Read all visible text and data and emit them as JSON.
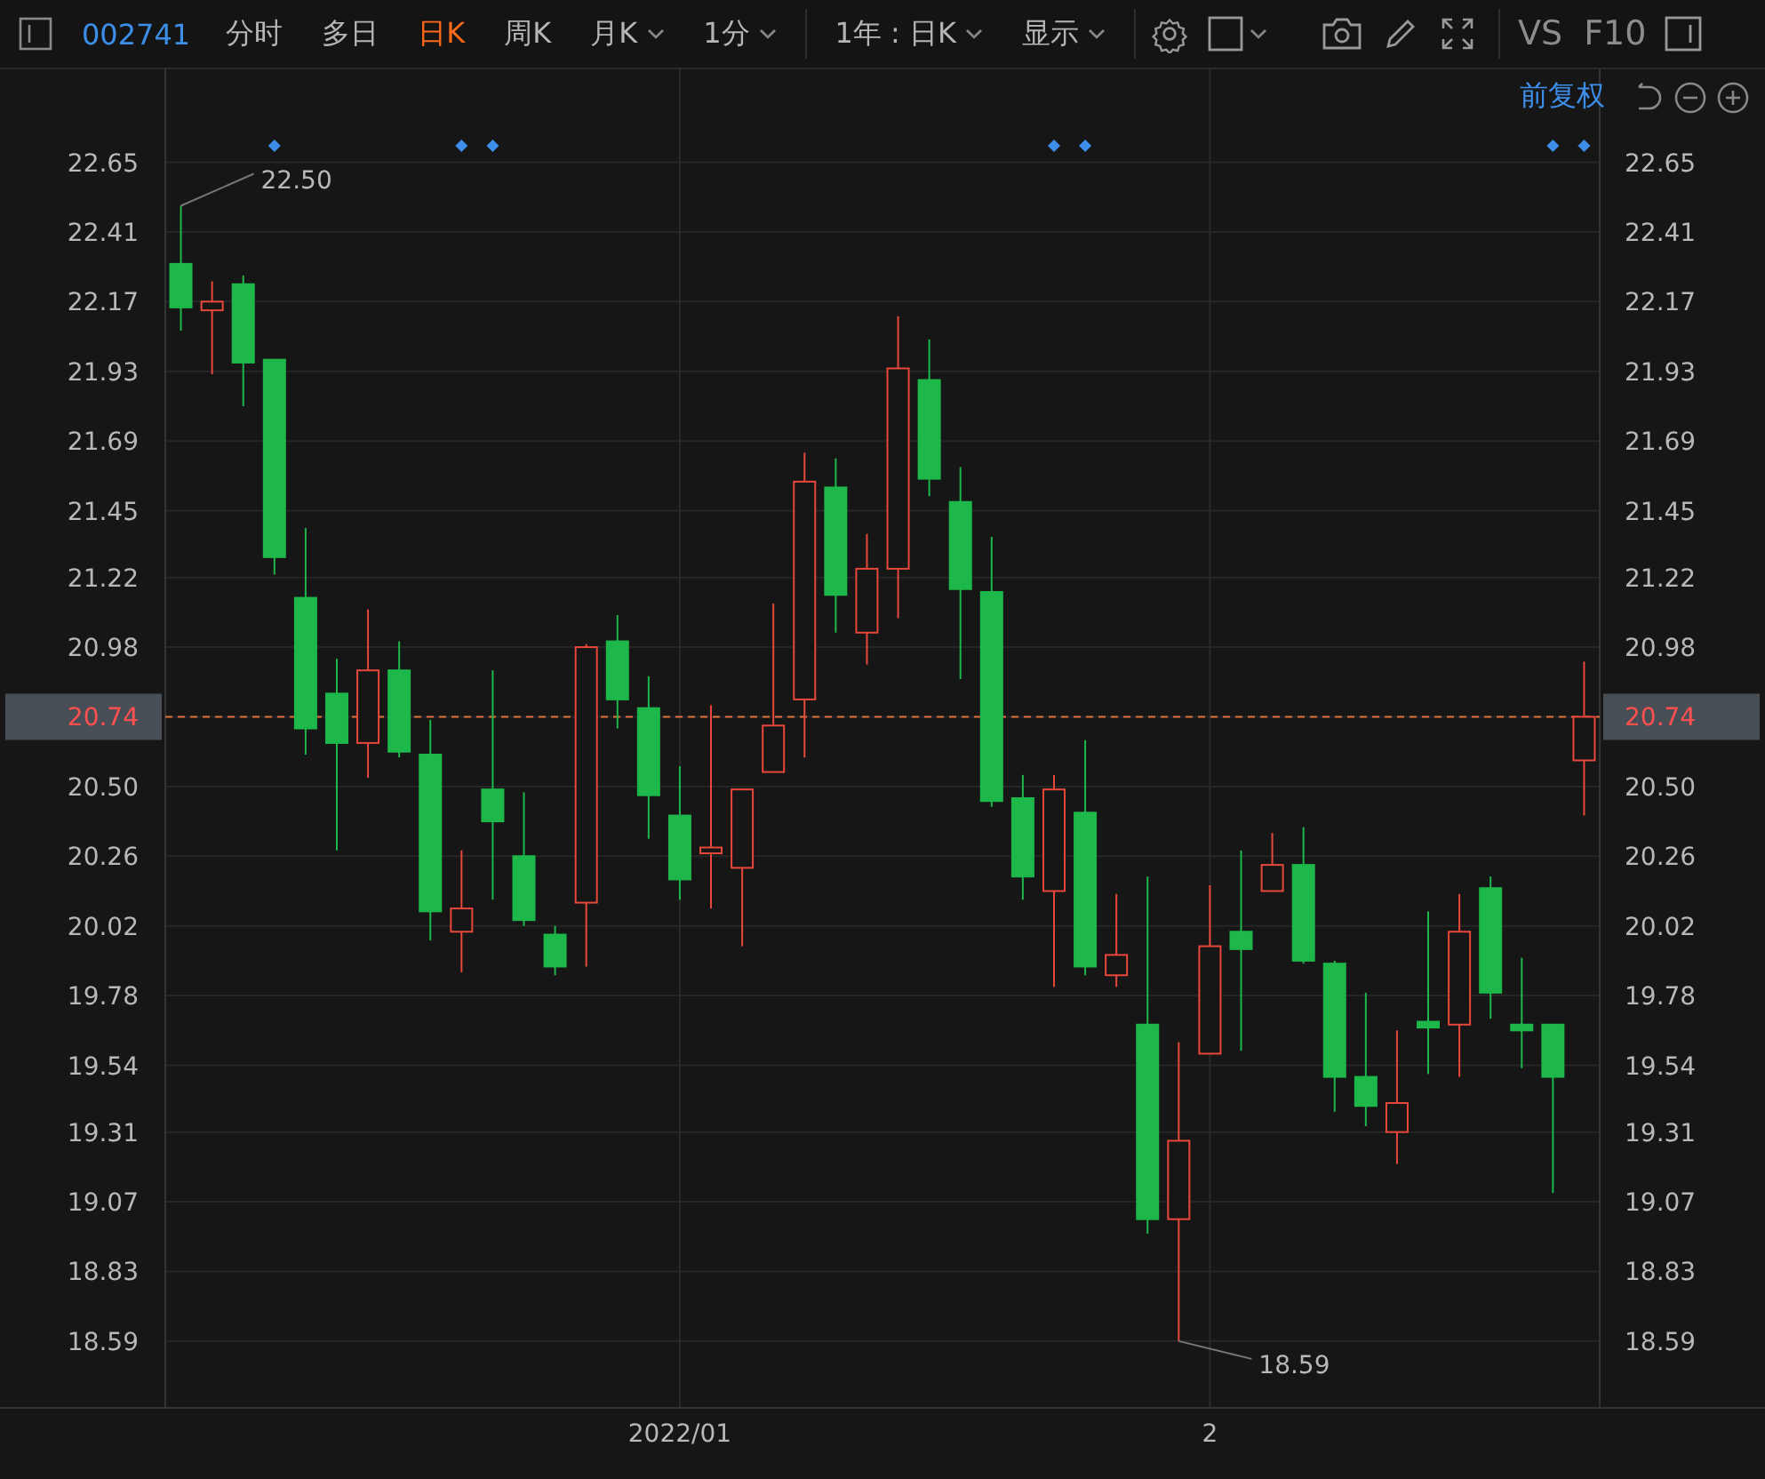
{
  "toolbar": {
    "symbol": "002741",
    "periods": [
      {
        "label": "分时",
        "selected": false,
        "dropdown": false
      },
      {
        "label": "多日",
        "selected": false,
        "dropdown": false
      },
      {
        "label": "日K",
        "selected": true,
        "dropdown": false
      },
      {
        "label": "周K",
        "selected": false,
        "dropdown": false
      },
      {
        "label": "月K",
        "selected": false,
        "dropdown": true
      },
      {
        "label": "1分",
        "selected": false,
        "dropdown": true
      }
    ],
    "range": "1年 : 日K",
    "display": "显示",
    "compare": "VS",
    "f10": "F10"
  },
  "adjust": "前复权",
  "event_flags": [
    false,
    false,
    false,
    true,
    false,
    false,
    false,
    false,
    false,
    true,
    true,
    false,
    false,
    false,
    false,
    false,
    false,
    false,
    false,
    false,
    false,
    false,
    false,
    false,
    false,
    false,
    false,
    false,
    true,
    true,
    false,
    false,
    false,
    false,
    false,
    false,
    false,
    false,
    false,
    false,
    false,
    false,
    false,
    false,
    true,
    true
  ],
  "chart_data": {
    "type": "candlestick",
    "grid": true,
    "ylim": [
      18.36,
      22.97
    ],
    "yticks": [
      {
        "value": 22.65,
        "label": "22.65"
      },
      {
        "value": 22.41,
        "label": "22.41"
      },
      {
        "value": 22.17,
        "label": "22.17"
      },
      {
        "value": 21.93,
        "label": "21.93"
      },
      {
        "value": 21.69,
        "label": "21.69"
      },
      {
        "value": 21.45,
        "label": "21.45"
      },
      {
        "value": 21.22,
        "label": "21.22"
      },
      {
        "value": 20.98,
        "label": "20.98"
      },
      {
        "value": 20.74,
        "label": "20.74"
      },
      {
        "value": 20.5,
        "label": "20.50"
      },
      {
        "value": 20.26,
        "label": "20.26"
      },
      {
        "value": 20.02,
        "label": "20.02"
      },
      {
        "value": 19.78,
        "label": "19.78"
      },
      {
        "value": 19.54,
        "label": "19.54"
      },
      {
        "value": 19.31,
        "label": "19.31"
      },
      {
        "value": 19.07,
        "label": "19.07"
      },
      {
        "value": 18.83,
        "label": "18.83"
      },
      {
        "value": 18.59,
        "label": "18.59"
      }
    ],
    "categories": [
      null,
      null,
      null,
      null,
      null,
      null,
      null,
      null,
      null,
      null,
      null,
      null,
      null,
      null,
      null,
      null,
      "2022/01",
      null,
      null,
      null,
      null,
      null,
      null,
      null,
      null,
      null,
      null,
      null,
      null,
      null,
      null,
      null,
      null,
      "2",
      null,
      null,
      null,
      null,
      null,
      null,
      null,
      null,
      null,
      null,
      null,
      null
    ],
    "ohlc": [
      [
        22.3,
        22.5,
        22.07,
        22.15
      ],
      [
        22.14,
        22.24,
        21.92,
        22.17
      ],
      [
        22.23,
        22.26,
        21.81,
        21.96
      ],
      [
        21.97,
        21.97,
        21.23,
        21.29
      ],
      [
        21.15,
        21.39,
        20.61,
        20.7
      ],
      [
        20.82,
        20.94,
        20.28,
        20.65
      ],
      [
        20.65,
        21.11,
        20.53,
        20.9
      ],
      [
        20.9,
        21.0,
        20.6,
        20.62
      ],
      [
        20.61,
        20.73,
        19.97,
        20.07
      ],
      [
        20.0,
        20.28,
        19.86,
        20.08
      ],
      [
        20.49,
        20.9,
        20.11,
        20.38
      ],
      [
        20.26,
        20.48,
        20.02,
        20.04
      ],
      [
        19.99,
        20.02,
        19.85,
        19.88
      ],
      [
        20.1,
        20.99,
        19.88,
        20.98
      ],
      [
        21.0,
        21.09,
        20.7,
        20.8
      ],
      [
        20.77,
        20.88,
        20.32,
        20.47
      ],
      [
        20.4,
        20.57,
        20.11,
        20.18
      ],
      [
        20.27,
        20.78,
        20.08,
        20.29
      ],
      [
        20.22,
        20.49,
        19.95,
        20.49
      ],
      [
        20.55,
        21.13,
        20.55,
        20.71
      ],
      [
        20.8,
        21.65,
        20.6,
        21.55
      ],
      [
        21.53,
        21.63,
        21.03,
        21.16
      ],
      [
        21.03,
        21.37,
        20.92,
        21.25
      ],
      [
        21.25,
        22.12,
        21.08,
        21.94
      ],
      [
        21.9,
        22.04,
        21.5,
        21.56
      ],
      [
        21.48,
        21.6,
        20.87,
        21.18
      ],
      [
        21.17,
        21.36,
        20.43,
        20.45
      ],
      [
        20.46,
        20.54,
        20.11,
        20.19
      ],
      [
        20.14,
        20.54,
        19.81,
        20.49
      ],
      [
        20.41,
        20.66,
        19.85,
        19.88
      ],
      [
        19.85,
        20.13,
        19.81,
        19.92
      ],
      [
        19.68,
        20.19,
        18.96,
        19.01
      ],
      [
        19.01,
        19.62,
        18.59,
        19.28
      ],
      [
        19.58,
        20.16,
        19.58,
        19.95
      ],
      [
        20.0,
        20.28,
        19.59,
        19.94
      ],
      [
        20.14,
        20.34,
        20.14,
        20.23
      ],
      [
        20.23,
        20.36,
        19.89,
        19.9
      ],
      [
        19.89,
        19.9,
        19.38,
        19.5
      ],
      [
        19.5,
        19.79,
        19.33,
        19.4
      ],
      [
        19.31,
        19.66,
        19.2,
        19.41
      ],
      [
        19.69,
        20.07,
        19.51,
        19.67
      ],
      [
        19.68,
        20.13,
        19.5,
        20.0
      ],
      [
        20.15,
        20.19,
        19.7,
        19.79
      ],
      [
        19.68,
        19.91,
        19.53,
        19.66
      ],
      [
        19.68,
        19.68,
        19.1,
        19.5
      ],
      [
        20.59,
        20.93,
        20.4,
        20.74
      ]
    ],
    "ref_lines": [
      {
        "axis": "y",
        "value": 20.74,
        "label": "20.74"
      }
    ],
    "annotations": [
      "22.50",
      "18.59"
    ]
  }
}
